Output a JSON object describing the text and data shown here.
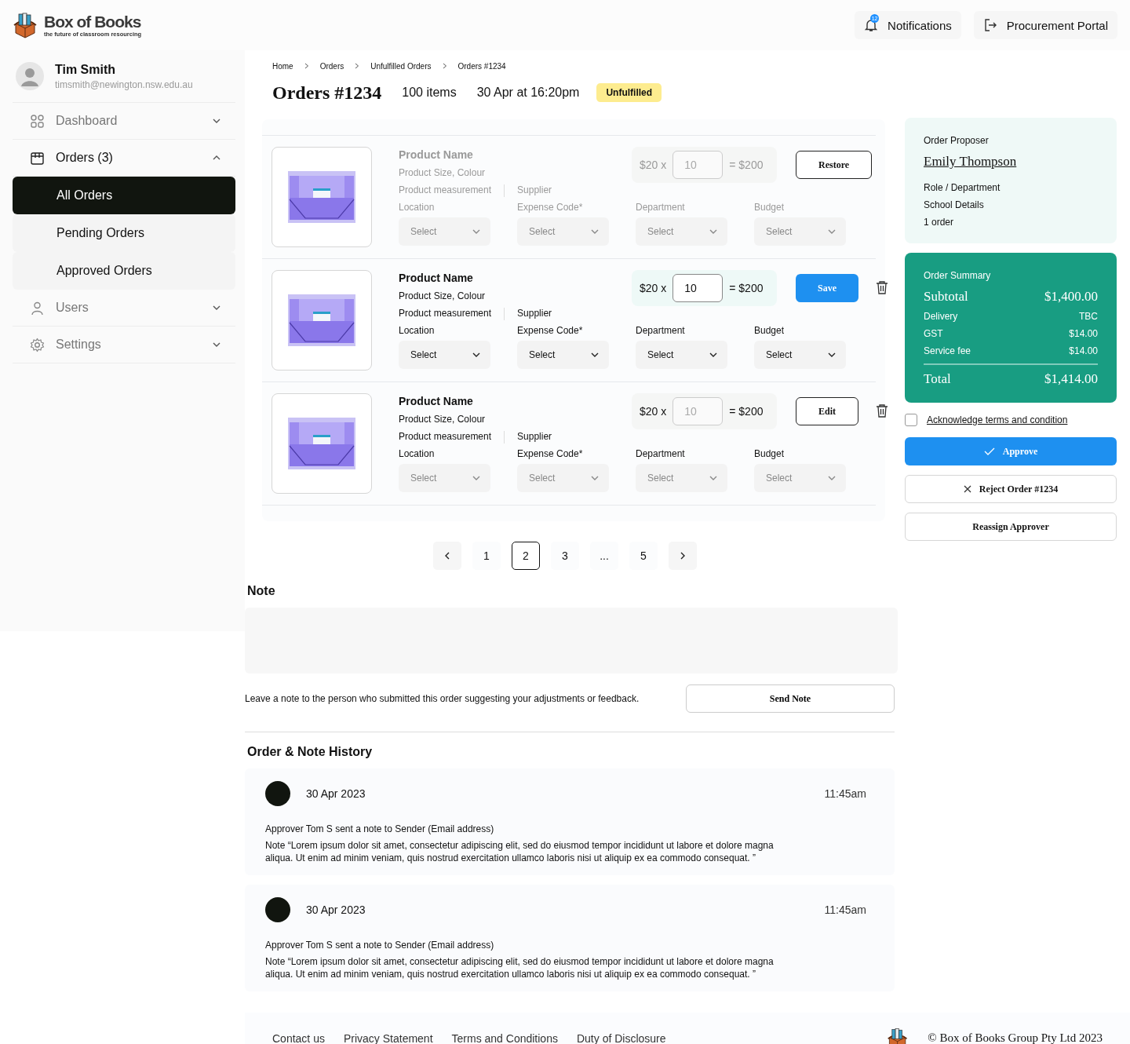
{
  "brand": {
    "name": "Box of Books",
    "tagline": "the future of classroom resourcing"
  },
  "header_actions": [
    {
      "kind": "bell",
      "label": "Notifications",
      "badge": "12"
    },
    {
      "kind": "exit",
      "label": "Procurement Portal"
    }
  ],
  "user": {
    "name": "Tim Smith",
    "email": "timsmith@newington.nsw.edu.au"
  },
  "sidebar": {
    "items": [
      {
        "kind": "grid",
        "label": "Dashboard",
        "expanded": false
      },
      {
        "kind": "calendar",
        "label": "Orders (3)",
        "expanded": true,
        "children": [
          {
            "label": "All Orders",
            "selected": true
          },
          {
            "label": "Pending Orders",
            "selected": false
          },
          {
            "label": "Approved Orders",
            "selected": false
          }
        ]
      },
      {
        "kind": "user",
        "label": "Users",
        "expanded": false
      },
      {
        "kind": "gear",
        "label": "Settings",
        "expanded": false
      }
    ]
  },
  "breadcrumb": [
    "Home",
    "Orders",
    "Unfulfilled Orders",
    "Orders #1234"
  ],
  "order": {
    "title": "Orders #1234",
    "items": "100 items",
    "date": "30 Apr at 16:20pm",
    "status": "Unfulfilled"
  },
  "products": [
    {
      "kind": "removed",
      "name": "Product Name",
      "variant": "Product Size, Colour",
      "measurement": "Product measurement",
      "supplier": "Supplier",
      "unit_price": "$20 x",
      "quantity": "10",
      "line_total": "= $200",
      "action": "Restore",
      "fields": [
        {
          "label": "Location",
          "placeholder": "Select"
        },
        {
          "label": "Expense Code*",
          "placeholder": "Select"
        },
        {
          "label": "Department",
          "placeholder": "Select"
        },
        {
          "label": "Budget",
          "placeholder": "Select"
        }
      ]
    },
    {
      "kind": "editing",
      "name": "Product Name",
      "variant": "Product Size, Colour",
      "measurement": "Product measurement",
      "supplier": "Supplier",
      "unit_price": "$20 x",
      "quantity": "10",
      "line_total": "= $200",
      "action": "Save",
      "fields": [
        {
          "label": "Location",
          "value": "Select"
        },
        {
          "label": "Expense Code*",
          "value": "Select"
        },
        {
          "label": "Department",
          "value": "Select"
        },
        {
          "label": "Budget",
          "value": "Select"
        }
      ]
    },
    {
      "kind": "saved",
      "name": "Product Name",
      "variant": "Product Size, Colour",
      "measurement": "Product measurement",
      "supplier": "Supplier",
      "unit_price": "$20 x",
      "quantity": "10",
      "line_total": "= $200",
      "action": "Edit",
      "fields": [
        {
          "label": "Location",
          "placeholder": "Select"
        },
        {
          "label": "Expense Code*",
          "placeholder": "Select"
        },
        {
          "label": "Department",
          "placeholder": "Select"
        },
        {
          "label": "Budget",
          "placeholder": "Select"
        }
      ]
    }
  ],
  "pagination": {
    "pages": [
      {
        "label": "1",
        "selected": false
      },
      {
        "label": "2",
        "selected": true
      },
      {
        "label": "3",
        "selected": false
      },
      {
        "label": "...",
        "selected": false
      },
      {
        "label": "5",
        "selected": false
      }
    ]
  },
  "note": {
    "title": "Note",
    "hint": "Leave a note to the person who submitted this order suggesting your adjustments or feedback.",
    "button": "Send Note"
  },
  "history": {
    "title": "Order & Note History",
    "entries": [
      {
        "date": "30 Apr 2023",
        "time": "11:45am",
        "summary": "Approver Tom S sent a note to Sender (Email address)",
        "note": "Note “Lorem ipsum dolor sit amet, consectetur adipiscing elit, sed do eiusmod tempor incididunt ut labore et dolore magna aliqua. Ut enim ad minim veniam, quis nostrud exercitation ullamco laboris nisi ut aliquip ex ea commodo consequat. ”"
      },
      {
        "date": "30 Apr 2023",
        "time": "11:45am",
        "summary": "Approver Tom S sent a note to Sender (Email address)",
        "note": "Note “Lorem ipsum dolor sit amet, consectetur adipiscing elit, sed do eiusmod tempor incididunt ut labore et dolore magna aliqua. Ut enim ad minim veniam, quis nostrud exercitation ullamco laboris nisi ut aliquip ex ea commodo consequat. ”"
      }
    ]
  },
  "proposer": {
    "heading": "Order Proposer",
    "name": "Emily Thompson",
    "details": [
      "Role / Department",
      "School Details",
      "1 order"
    ]
  },
  "summary": {
    "heading": "Order Summary",
    "lines": [
      {
        "kind": "major",
        "label": "Subtotal",
        "value": "$1,400.00"
      },
      {
        "kind": "minor",
        "label": "Delivery",
        "value": "TBC"
      },
      {
        "kind": "minor",
        "label": "GST",
        "value": "$14.00"
      },
      {
        "kind": "minor",
        "label": "Service fee",
        "value": "$14.00"
      }
    ],
    "total": {
      "label": "Total",
      "value": "$1,414.00"
    }
  },
  "terms": {
    "label": "Acknowledge terms and condition",
    "checked": false
  },
  "actions": [
    {
      "kind": "approve",
      "label": "Approve"
    },
    {
      "kind": "reject",
      "label": "Reject Order #1234"
    },
    {
      "kind": "plain",
      "label": "Reassign Approver"
    }
  ],
  "footer": {
    "links": [
      "Contact us",
      "Privacy Statement",
      "Terms and Conditions",
      "Duty of Disclosure"
    ],
    "copyright": "© Box of Books Group Pty Ltd 2023"
  }
}
